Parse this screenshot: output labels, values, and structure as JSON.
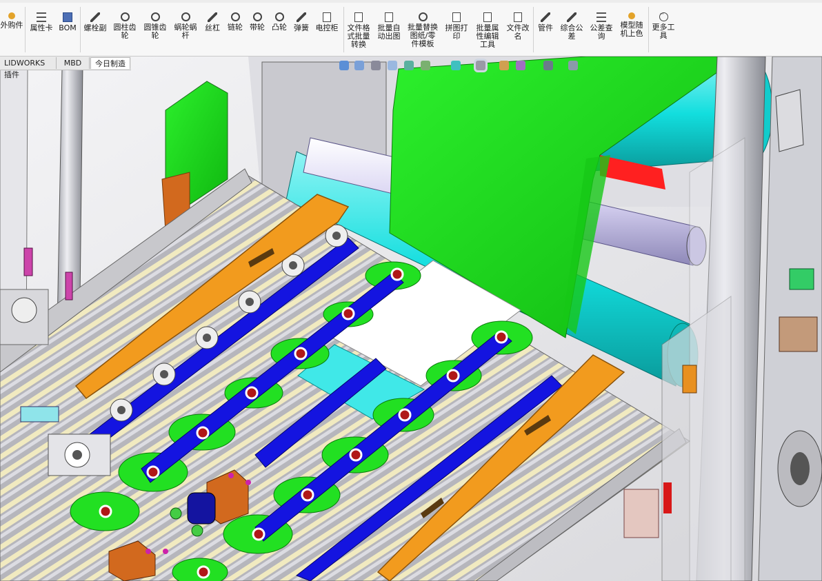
{
  "toolbar": {
    "buttons": [
      {
        "label": "外购件",
        "icon": "orange-part-icon"
      },
      {
        "label": "属性卡",
        "icon": "property-card-icon"
      },
      {
        "label": "BOM",
        "icon": "bom-icon"
      },
      {
        "label": "螺栓副",
        "icon": "bolt-icon"
      },
      {
        "label": "圆柱齿\n轮",
        "icon": "spur-gear-icon"
      },
      {
        "label": "圆锥齿\n轮",
        "icon": "bevel-gear-icon"
      },
      {
        "label": "蜗轮蜗\n杆",
        "icon": "worm-gear-icon"
      },
      {
        "label": "丝杠",
        "icon": "lead-screw-icon"
      },
      {
        "label": "链轮",
        "icon": "sprocket-icon"
      },
      {
        "label": "带轮",
        "icon": "pulley-icon"
      },
      {
        "label": "凸轮",
        "icon": "cam-icon"
      },
      {
        "label": "弹簧",
        "icon": "spring-icon"
      },
      {
        "label": "电控柜",
        "icon": "cabinet-icon"
      },
      {
        "label": "文件格\n式批量\n转换",
        "icon": "batch-convert-icon"
      },
      {
        "label": "批量自\n动出图",
        "icon": "auto-drawing-icon"
      },
      {
        "label": "批量替换\n图纸/零\n件模板",
        "icon": "template-replace-icon"
      },
      {
        "label": "拼图打\n印",
        "icon": "print-icon"
      },
      {
        "label": "批量属\n性编辑\n工具",
        "icon": "property-edit-icon"
      },
      {
        "label": "文件改\n名",
        "icon": "rename-icon"
      },
      {
        "label": "管件",
        "icon": "pipe-icon"
      },
      {
        "label": "综合公\n差",
        "icon": "tolerance-icon"
      },
      {
        "label": "公差查\n询",
        "icon": "tolerance-query-icon"
      },
      {
        "label": "模型随\n机上色",
        "icon": "random-color-icon"
      },
      {
        "label": "更多工\n具",
        "icon": "more-tools-icon"
      }
    ]
  },
  "tabs": [
    {
      "label": "LIDWORKS 插件",
      "active": false
    },
    {
      "label": "MBD",
      "active": false
    },
    {
      "label": "今日制造",
      "active": true
    }
  ],
  "hud": {
    "icons": [
      "zoom-fit-icon",
      "zoom-area-icon",
      "previous-view-icon",
      "section-view-icon",
      "dynamic-annotation-icon",
      "view-orientation-icon",
      "display-style-icon",
      "hide-show-icon",
      "edit-appearance-icon",
      "scene-icon",
      "display-settings-icon",
      "view-settings-icon"
    ]
  },
  "colors": {
    "green": "#1fe61f",
    "cyan": "#16e0e0",
    "blue": "#1414e0",
    "orange": "#f29b1e",
    "frame": "#c8c8cc",
    "rail_cream": "#f1eac0"
  }
}
